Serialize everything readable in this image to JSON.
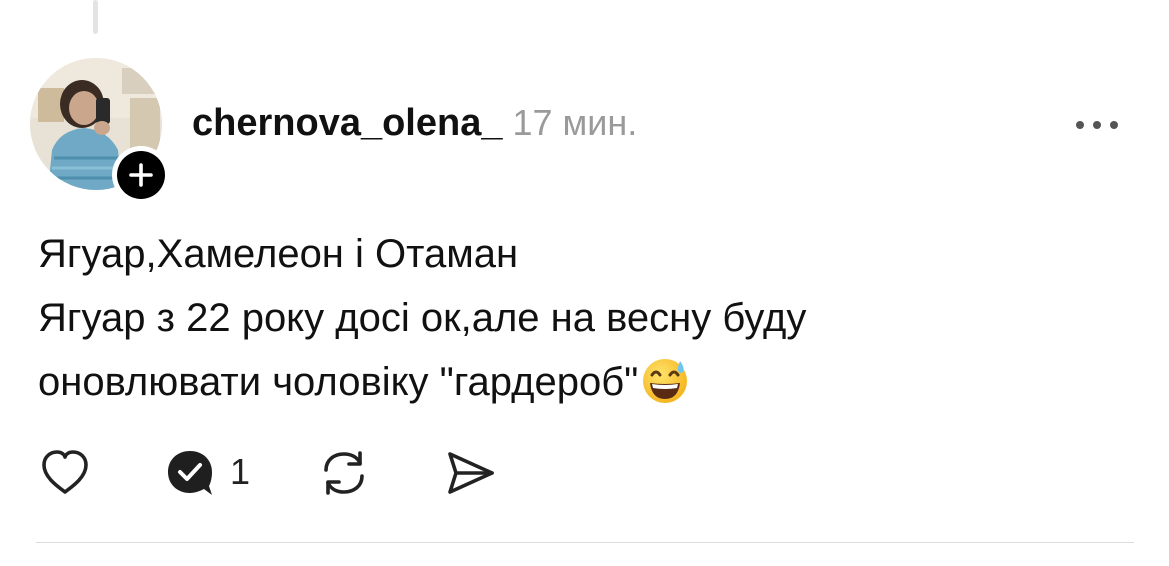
{
  "post": {
    "username": "chernova_olena_",
    "time": "17 мин.",
    "text_lines": [
      "Ягуар,Хамелеон і Отаман",
      "Ягуар з 22 року досі ок,але на весну буду",
      "оновлювати чоловіку \"гардероб\""
    ],
    "trailing_emoji": "grinning-face-with-sweat-icon"
  },
  "actions": {
    "reply_count": "1"
  },
  "icons": {
    "like": "heart-icon",
    "reply": "comment-bubble-check-icon",
    "repost": "repost-arrows-icon",
    "share": "send-icon",
    "more": "more-dots-icon",
    "follow": "plus-icon"
  },
  "colors": {
    "text": "#111111",
    "muted": "#9a9a9a",
    "follow_badge": "#000000",
    "divider": "#dcdcdc"
  }
}
